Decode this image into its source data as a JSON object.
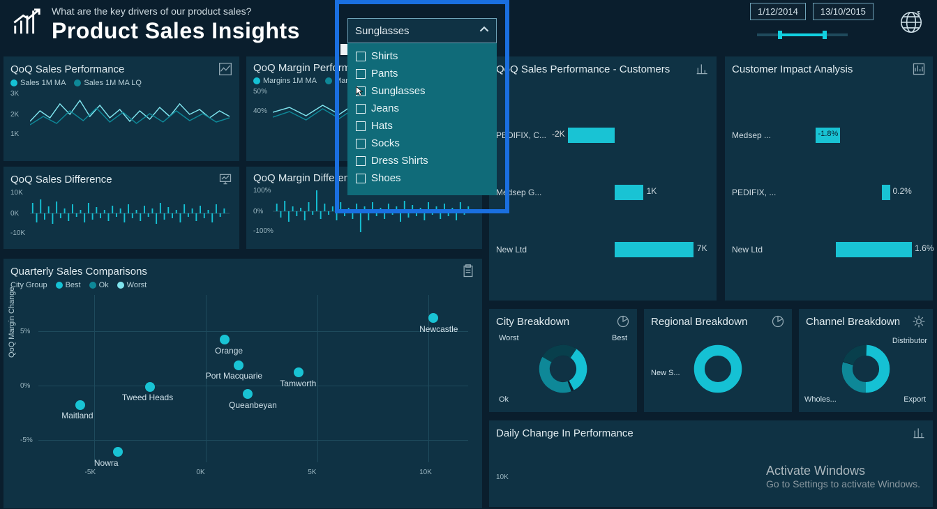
{
  "header": {
    "subtitle": "What are the key drivers of our product sales?",
    "title": "Product Sales Insights",
    "date_from": "1/12/2014",
    "date_to": "13/10/2015"
  },
  "dropdown": {
    "selected": "Sunglasses",
    "options": [
      "Shirts",
      "Pants",
      "Sunglasses",
      "Jeans",
      "Hats",
      "Socks",
      "Dress Shirts",
      "Shoes"
    ]
  },
  "cards": {
    "qoq_sales": {
      "title": "QoQ Sales Performance",
      "legend_a": "Sales 1M MA",
      "legend_b": "Sales 1M MA LQ",
      "y_ticks": [
        "3K",
        "2K",
        "1K"
      ]
    },
    "qoq_margin": {
      "title": "QoQ Margin Performance",
      "legend_a": "Margins 1M MA",
      "legend_b": "Margins",
      "y_ticks": [
        "50%",
        "40%"
      ]
    },
    "qoq_sales_diff": {
      "title": "QoQ Sales Difference",
      "y_ticks": [
        "10K",
        "0K",
        "-10K"
      ]
    },
    "qoq_margin_diff": {
      "title": "QoQ Margin Difference",
      "y_ticks": [
        "100%",
        "0%",
        "-100%"
      ]
    },
    "qoq_customers": {
      "title": "QoQ Sales Performance - Customers",
      "rows": [
        {
          "label": "PEDIFIX, C...",
          "value": "-2K",
          "pct": -0.25
        },
        {
          "label": "Medsep G...",
          "value": "1K",
          "pct": 0.15
        },
        {
          "label": "New Ltd",
          "value": "7K",
          "pct": 0.9
        }
      ]
    },
    "impact": {
      "title": "Customer Impact Analysis",
      "rows": [
        {
          "label": "Medsep ...",
          "value": "-1.8%",
          "pct": -0.25
        },
        {
          "label": "PEDIFIX, ...",
          "value": "0.2%",
          "pct": 0.05
        },
        {
          "label": "New Ltd",
          "value": "1.6%",
          "pct": 0.55
        }
      ]
    },
    "quarterly": {
      "title": "Quarterly Sales Comparisons",
      "legend_title": "City Group",
      "legend_a": "Best",
      "legend_b": "Ok",
      "legend_c": "Worst",
      "y_title": "QoQ Margin Change",
      "y_ticks": [
        "5%",
        "0%",
        "-5%"
      ],
      "x_ticks": [
        "-5K",
        "0K",
        "5K",
        "10K"
      ],
      "points": [
        {
          "label": "Newcastle",
          "x": 0.92,
          "y": 0.12
        },
        {
          "label": "Orange",
          "x": 0.44,
          "y": 0.3
        },
        {
          "label": "Port Macquarie",
          "x": 0.48,
          "y": 0.42
        },
        {
          "label": "Tamworth",
          "x": 0.6,
          "y": 0.46
        },
        {
          "label": "Tweed Heads",
          "x": 0.3,
          "y": 0.54
        },
        {
          "label": "Queanbeyan",
          "x": 0.5,
          "y": 0.58
        },
        {
          "label": "Maitland",
          "x": 0.14,
          "y": 0.64
        },
        {
          "label": "Nowra",
          "x": 0.22,
          "y": 0.9
        }
      ]
    },
    "city_breakdown": {
      "title": "City Breakdown",
      "labels": [
        "Worst",
        "Best",
        "Ok"
      ]
    },
    "regional_breakdown": {
      "title": "Regional Breakdown",
      "labels": [
        "New S..."
      ]
    },
    "channel_breakdown": {
      "title": "Channel Breakdown",
      "labels": [
        "Distributor",
        "Wholes...",
        "Export"
      ]
    },
    "daily_change": {
      "title": "Daily Change In Performance",
      "y_ticks": [
        "10K"
      ]
    }
  },
  "watermark": {
    "title": "Activate Windows",
    "sub": "Go to Settings to activate Windows."
  }
}
